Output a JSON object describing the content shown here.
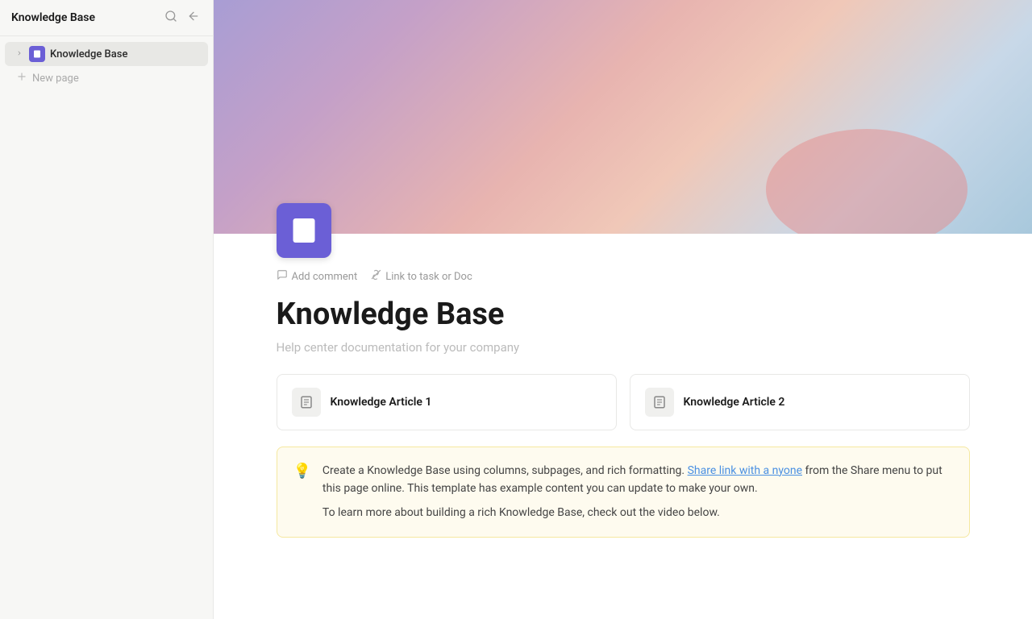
{
  "sidebar": {
    "title": "Knowledge Base",
    "search_icon": "🔍",
    "collapse_icon": "⊣",
    "items": [
      {
        "id": "knowledge-base",
        "label": "Knowledge Base",
        "active": true
      }
    ],
    "new_page_label": "New page"
  },
  "toolbar": {
    "add_comment_label": "Add comment",
    "link_label": "Link to task or Doc"
  },
  "page": {
    "title": "Knowledge Base",
    "subtitle": "Help center documentation for your company",
    "articles": [
      {
        "label": "Knowledge Article 1"
      },
      {
        "label": "Knowledge Article 2"
      }
    ],
    "info_text_before_link": "Create a Knowledge Base using columns, subpages, and rich formatting. ",
    "info_link_text": "Share link with a nyone",
    "info_text_after_link": " from the Share menu to put this page online. This template has example content you can update to make your own.",
    "info_text2": "To learn more about building a rich Knowledge Base, check out the video below."
  }
}
